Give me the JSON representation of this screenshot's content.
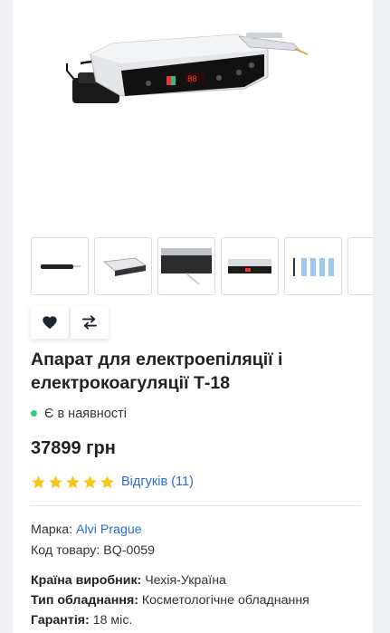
{
  "product": {
    "title": "Апарат для електроепіляції і електрокоагуляції Т-18",
    "availability": "Є в наявності",
    "price": "37899 грн",
    "rating": 5,
    "rating_max": 5,
    "reviews_label": "Відгуків (11)",
    "main_image": "electrolysis-device-photo",
    "thumbnails": [
      {
        "name": "handpiece-thumbnail"
      },
      {
        "name": "device-side-thumbnail"
      },
      {
        "name": "device-panel-thumbnail"
      },
      {
        "name": "device-front-thumbnail"
      },
      {
        "name": "needles-thumbnail"
      },
      {
        "name": "partial-thumbnail"
      }
    ]
  },
  "actions": {
    "favorite_icon": "heart-icon",
    "compare_icon": "compare-arrows-icon"
  },
  "specs": {
    "brand_label": "Марка: ",
    "brand_value": "Alvi Prague",
    "code_label": "Код товару: ",
    "code_value": "BQ-0059",
    "country_label": "Країна виробник:",
    "country_value": " Чехія-Україна",
    "type_label": "Тип обладнання:",
    "type_value": " Косметологічне обладнання",
    "warranty_label": "Гарантія:",
    "warranty_value": " 18 міс."
  },
  "colors": {
    "accent_link": "#2b6bd6",
    "star": "#f5c518",
    "in_stock_dot": "#3cc87a"
  }
}
